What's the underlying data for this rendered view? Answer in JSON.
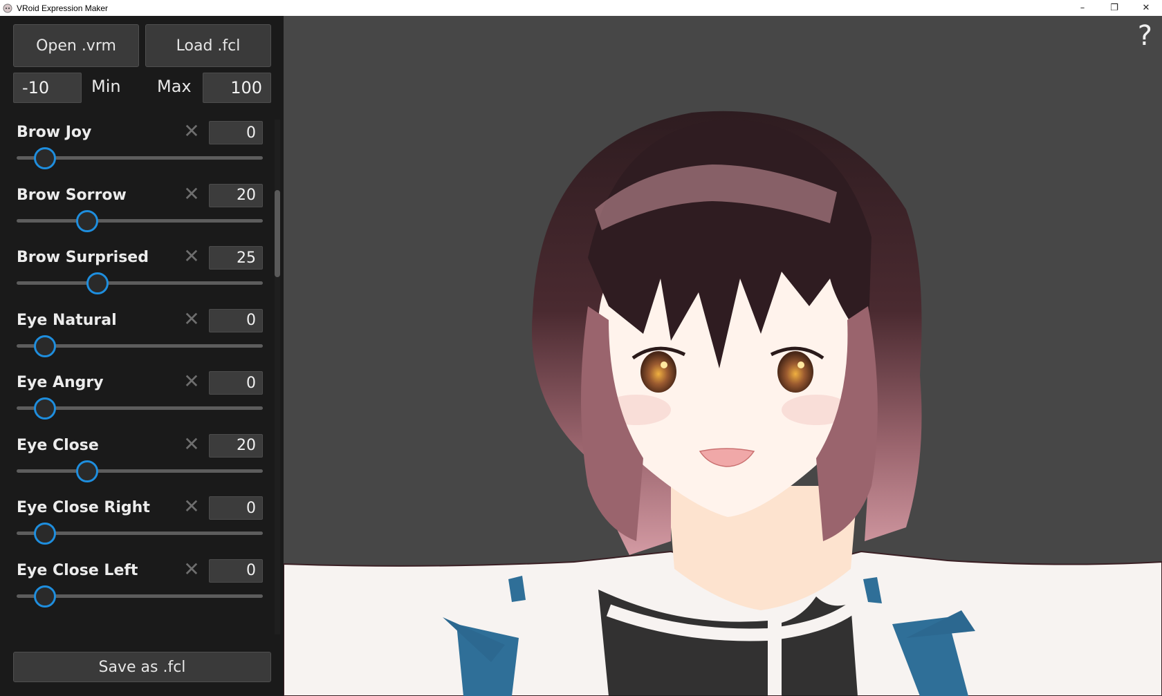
{
  "window": {
    "title": "VRoid Expression Maker",
    "minimize": "–",
    "restore": "❐",
    "close": "✕"
  },
  "toolbar": {
    "open_label": "Open .vrm",
    "load_label": "Load .fcl",
    "min_value": "-10",
    "min_label": "Min",
    "max_label": "Max",
    "max_value": "100",
    "save_label": "Save as .fcl"
  },
  "expressions": [
    {
      "label": "Brow Joy",
      "value": 0
    },
    {
      "label": "Brow Sorrow",
      "value": 20
    },
    {
      "label": "Brow Surprised",
      "value": 25
    },
    {
      "label": "Eye Natural",
      "value": 0
    },
    {
      "label": "Eye Angry",
      "value": 0
    },
    {
      "label": "Eye Close",
      "value": 20
    },
    {
      "label": "Eye Close Right",
      "value": 0
    },
    {
      "label": "Eye Close Left",
      "value": 0
    }
  ],
  "slider_range": {
    "min": -10,
    "max": 100
  },
  "viewport": {
    "help_label": "?"
  },
  "colors": {
    "accent": "#1e8ede",
    "hair_dark": "#3a2227",
    "hair_tip": "#c98f98",
    "ribbon": "#2f6f98",
    "skin": "#fff0e8"
  }
}
